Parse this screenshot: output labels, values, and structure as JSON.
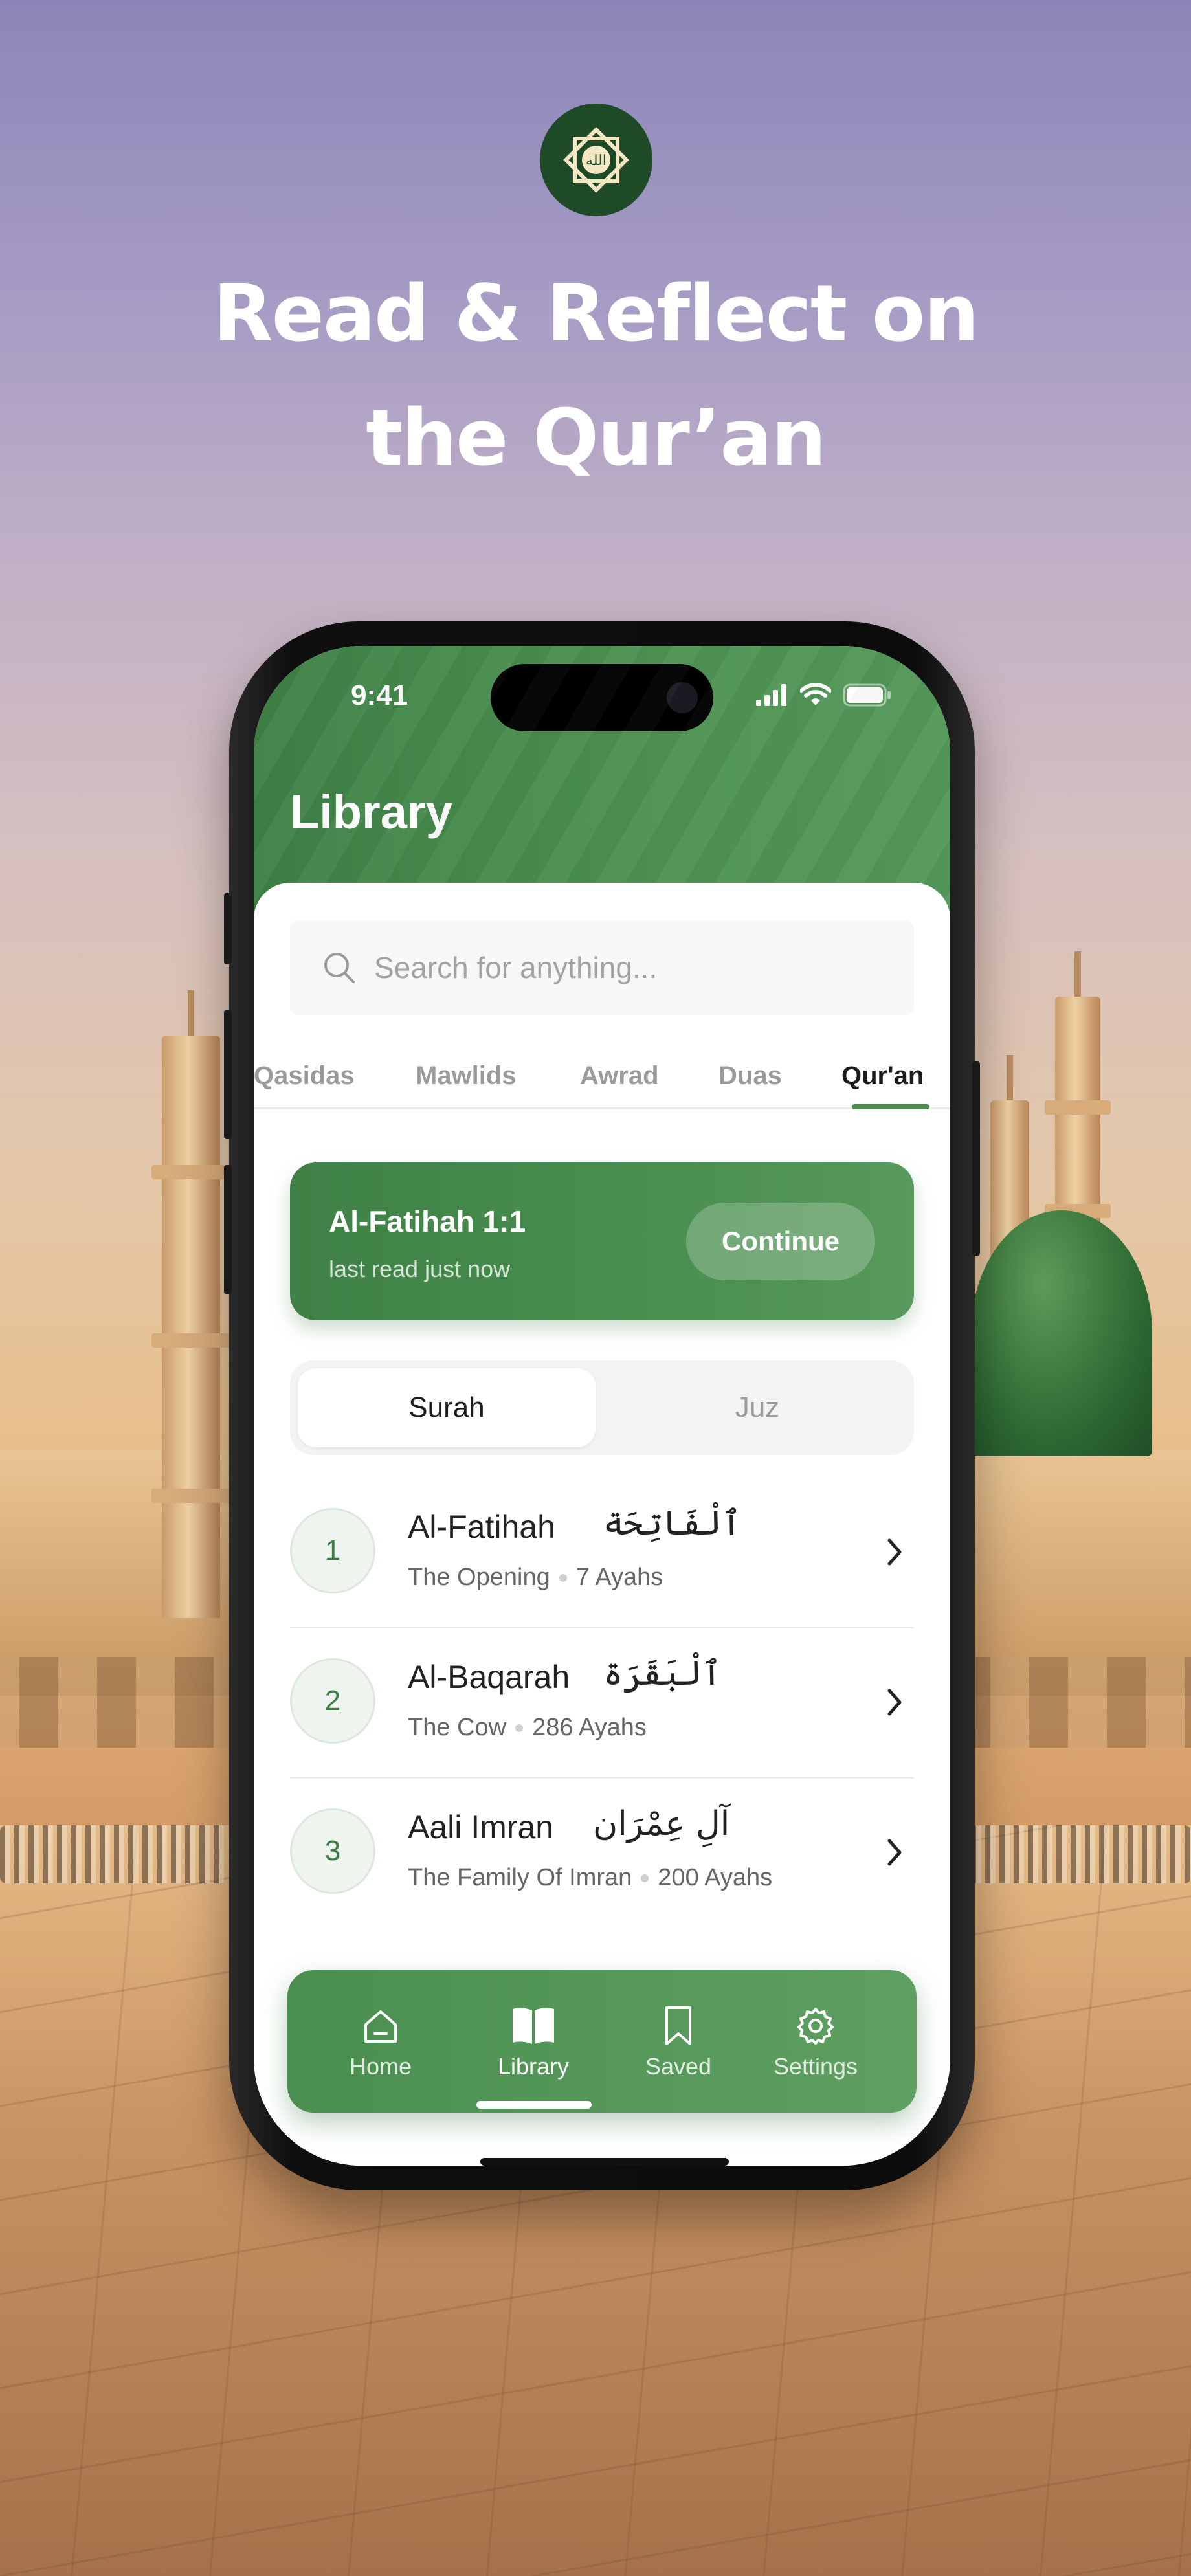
{
  "promo": {
    "headline_line1": "Read & Reflect on",
    "headline_line2": "the Qur’an",
    "logo_icon": "allah-star-logo-icon"
  },
  "status_bar": {
    "time": "9:41",
    "icons": [
      "signal-icon",
      "wifi-icon",
      "battery-icon"
    ]
  },
  "header": {
    "title": "Library"
  },
  "search": {
    "placeholder": "Search for anything..."
  },
  "tabs": [
    {
      "label": "Qasidas",
      "active": false
    },
    {
      "label": "Mawlids",
      "active": false
    },
    {
      "label": "Awrad",
      "active": false
    },
    {
      "label": "Duas",
      "active": false
    },
    {
      "label": "Qur'an",
      "active": true
    }
  ],
  "continue_card": {
    "title": "Al-Fatihah 1:1",
    "subtitle": "last read just now",
    "button": "Continue"
  },
  "segment": {
    "options": [
      "Surah",
      "Juz"
    ],
    "selected": "Surah"
  },
  "surahs": [
    {
      "number": "1",
      "name": "Al-Fatihah",
      "arabic": "ٱلْفَاتِحَة",
      "translation": "The Opening",
      "ayahs": "7 Ayahs"
    },
    {
      "number": "2",
      "name": "Al-Baqarah",
      "arabic": "ٱلْبَقَرَة",
      "translation": "The Cow",
      "ayahs": "286 Ayahs"
    },
    {
      "number": "3",
      "name": "Aali Imran",
      "arabic": "آلِ عِمْرَان",
      "translation": "The Family Of Imran",
      "ayahs": "200 Ayahs"
    }
  ],
  "bottom_nav": [
    {
      "label": "Home",
      "icon": "home-icon",
      "active": false
    },
    {
      "label": "Library",
      "icon": "book-icon",
      "active": true
    },
    {
      "label": "Saved",
      "icon": "bookmark-icon",
      "active": false
    },
    {
      "label": "Settings",
      "icon": "gear-icon",
      "active": false
    }
  ],
  "colors": {
    "primary_green": "#4a8f50",
    "dark_green": "#1f4a27",
    "accent_light_green": "#eef5ee"
  }
}
